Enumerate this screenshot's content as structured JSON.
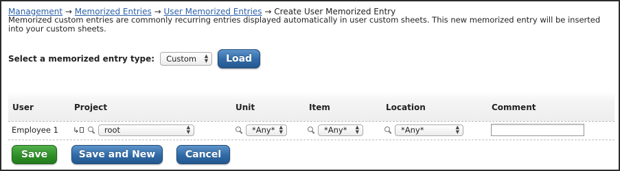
{
  "breadcrumb": {
    "items": [
      {
        "label": "Management",
        "link": true
      },
      {
        "label": "Memorized Entries",
        "link": true
      },
      {
        "label": "User Memorized Entries",
        "link": true
      },
      {
        "label": "Create User Memorized Entry",
        "link": false
      }
    ],
    "separator": "→"
  },
  "description": "Memorized custom entries are commonly recurring entries displayed automatically in user custom sheets. This new memorized entry will be inserted into your custom sheets.",
  "entry_type": {
    "label": "Select a memorized entry type:",
    "selected": "Custom",
    "load_label": "Load"
  },
  "grid": {
    "headers": {
      "user": "User",
      "project": "Project",
      "unit": "Unit",
      "item": "Item",
      "location": "Location",
      "comment": "Comment"
    },
    "row": {
      "user": "Employee 1",
      "project": "root",
      "unit": "*Any*",
      "item": "*Any*",
      "location": "*Any*",
      "comment": ""
    }
  },
  "actions": {
    "save": "Save",
    "save_and_new": "Save and New",
    "cancel": "Cancel"
  },
  "colors": {
    "link": "#2a5fa8",
    "button_blue": "#2f6aa6",
    "button_green": "#2f8f28"
  },
  "icons": [
    "magnifier-icon",
    "tree-icon",
    "select-arrows-icon"
  ]
}
